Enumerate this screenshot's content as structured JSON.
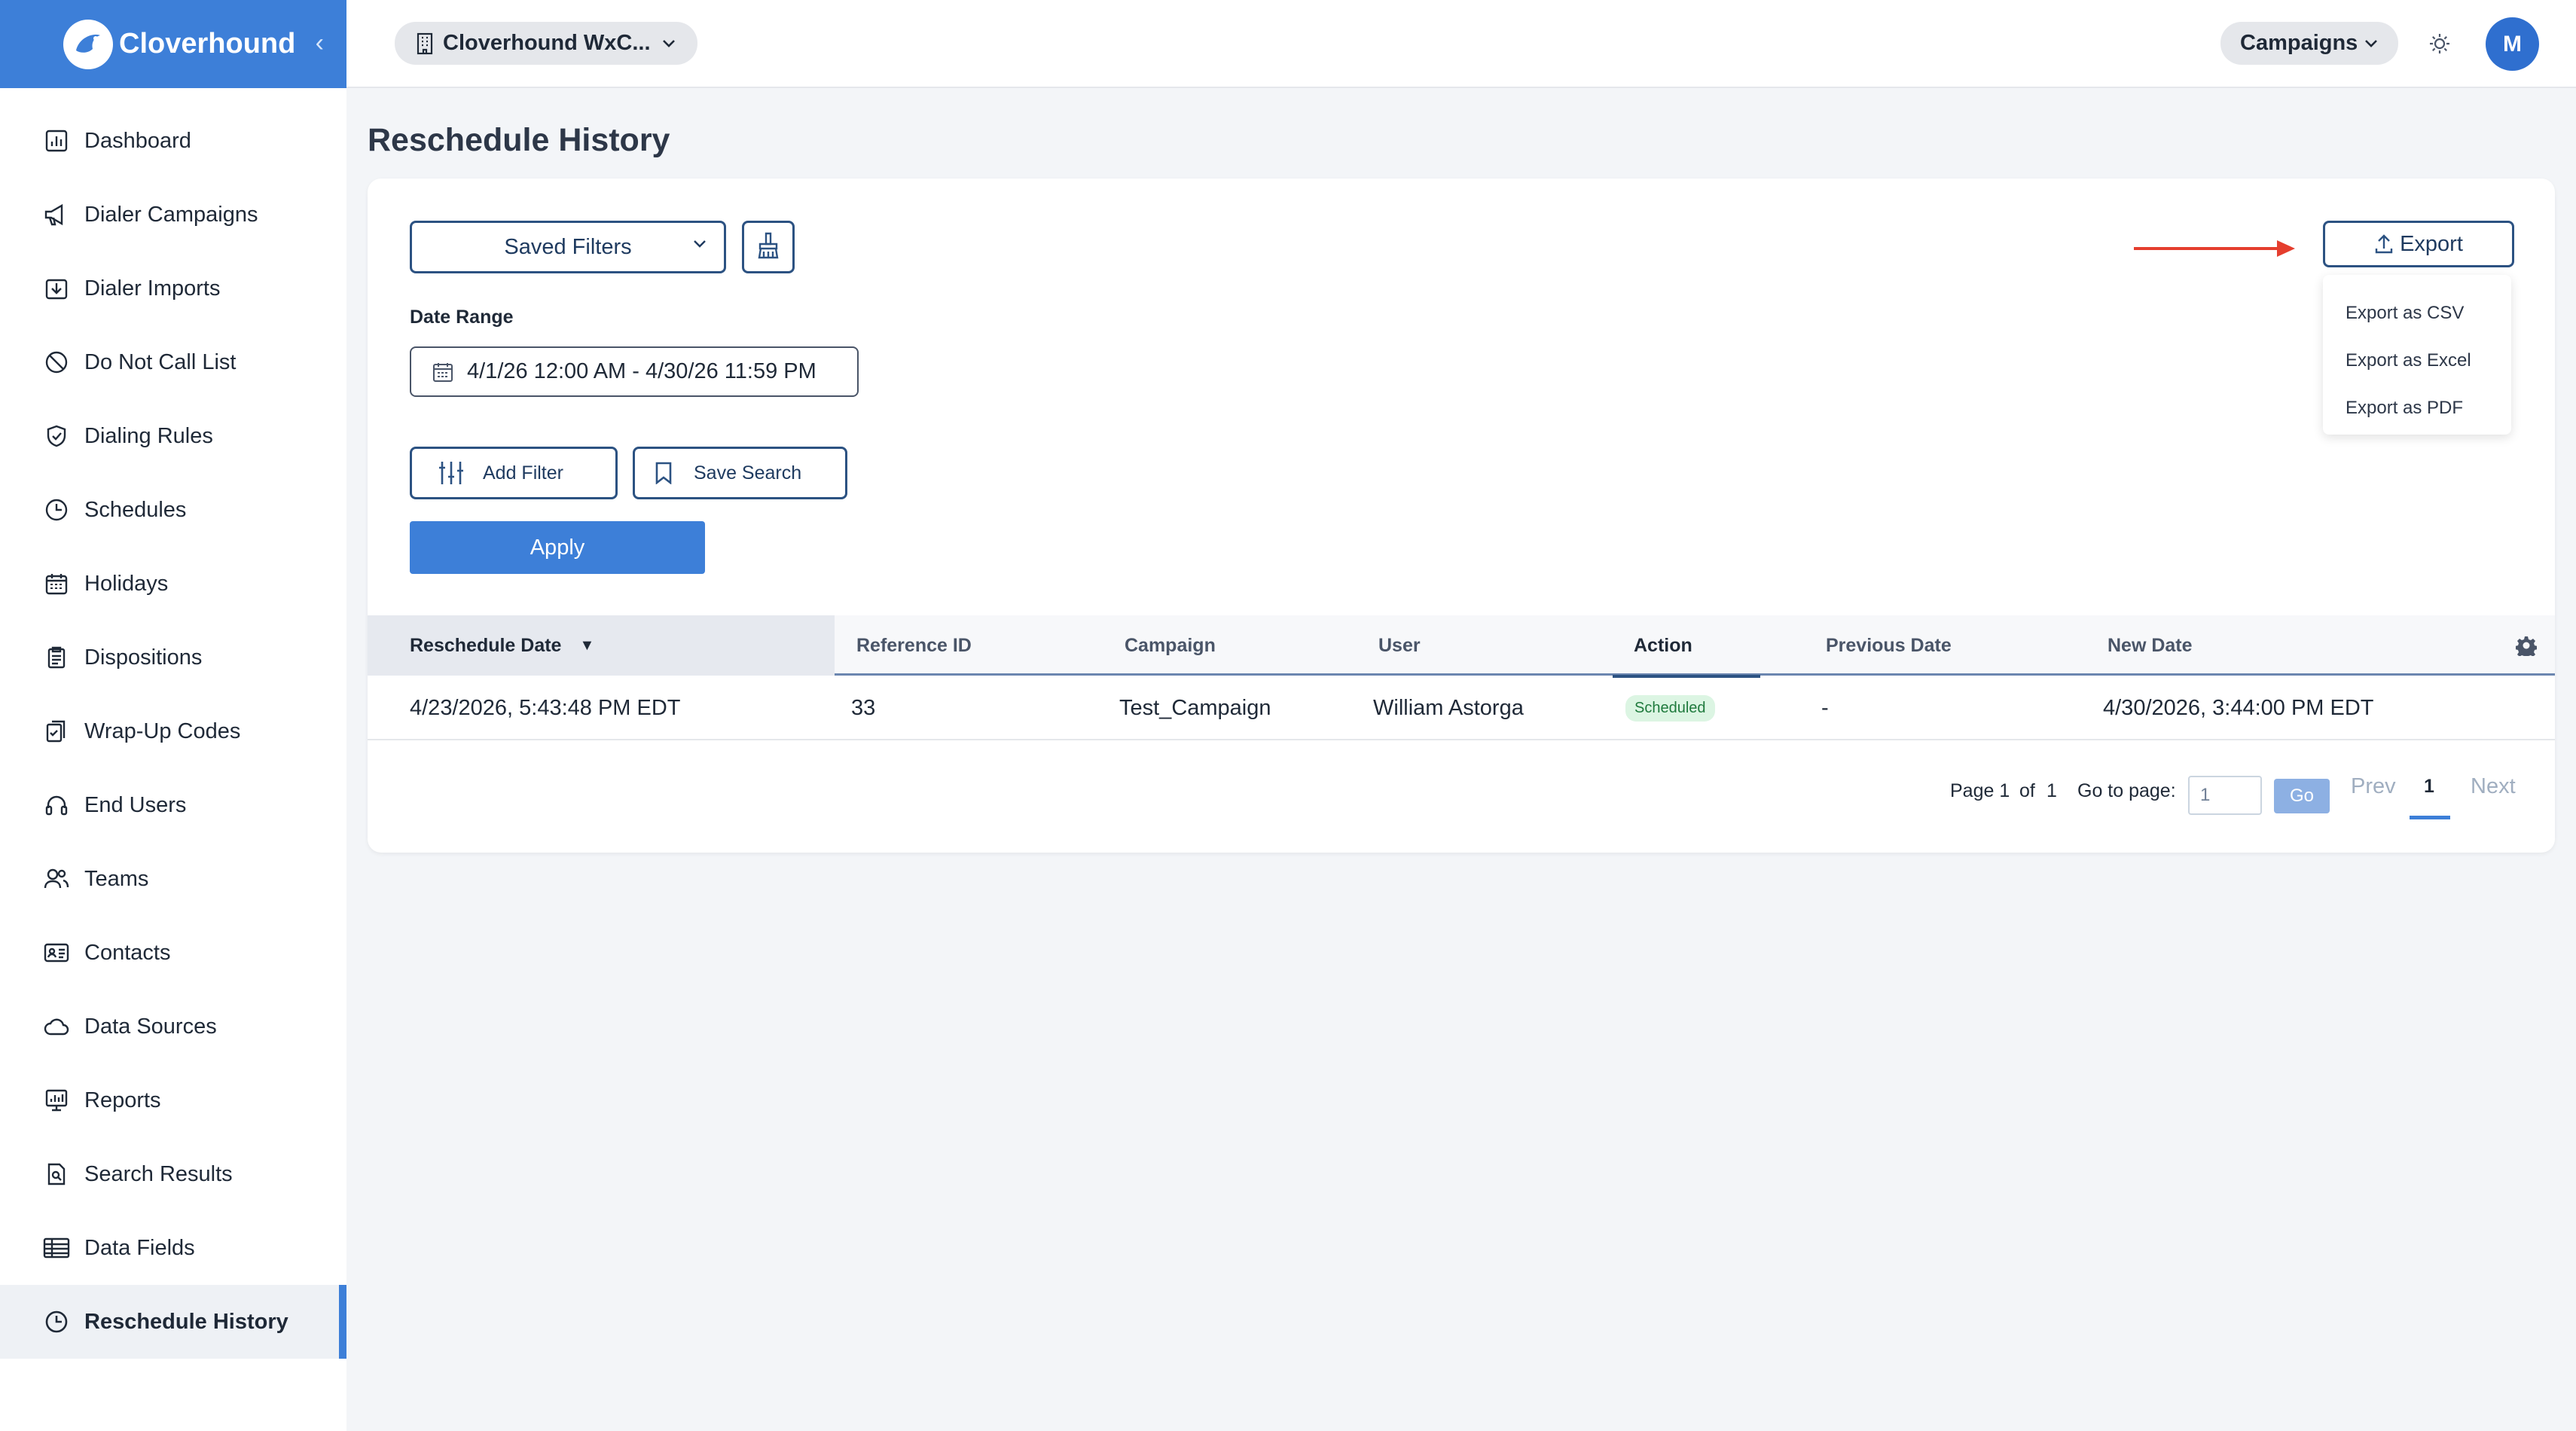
{
  "brand": {
    "name": "Cloverhound"
  },
  "sidebar": {
    "items": [
      {
        "label": "Dashboard",
        "icon": "dashboard-icon"
      },
      {
        "label": "Dialer Campaigns",
        "icon": "megaphone-icon"
      },
      {
        "label": "Dialer Imports",
        "icon": "import-icon"
      },
      {
        "label": "Do Not Call List",
        "icon": "prohibited-icon"
      },
      {
        "label": "Dialing Rules",
        "icon": "shield-icon"
      },
      {
        "label": "Schedules",
        "icon": "clock-icon"
      },
      {
        "label": "Holidays",
        "icon": "calendar-icon"
      },
      {
        "label": "Dispositions",
        "icon": "clipboard-icon"
      },
      {
        "label": "Wrap-Up Codes",
        "icon": "clipboard-check-icon"
      },
      {
        "label": "End Users",
        "icon": "headset-icon"
      },
      {
        "label": "Teams",
        "icon": "users-icon"
      },
      {
        "label": "Contacts",
        "icon": "contact-card-icon"
      },
      {
        "label": "Data Sources",
        "icon": "cloud-icon"
      },
      {
        "label": "Reports",
        "icon": "report-icon"
      },
      {
        "label": "Search Results",
        "icon": "search-document-icon"
      },
      {
        "label": "Data Fields",
        "icon": "table-icon"
      },
      {
        "label": "Reschedule History",
        "icon": "clock-icon",
        "active": true
      }
    ]
  },
  "header": {
    "org": "Cloverhound WxC...",
    "module": "Campaigns",
    "avatar": "M"
  },
  "page": {
    "title": "Reschedule History"
  },
  "filters": {
    "saved_filters": "Saved Filters",
    "date_range_label": "Date Range",
    "date_range_value": "4/1/26 12:00 AM - 4/30/26 11:59 PM",
    "add_filter": "Add Filter",
    "save_search": "Save Search",
    "apply": "Apply"
  },
  "export": {
    "button": "Export",
    "menu": [
      "Export as CSV",
      "Export as Excel",
      "Export as PDF"
    ]
  },
  "table": {
    "columns": [
      "Reschedule Date",
      "Reference ID",
      "Campaign",
      "User",
      "Action",
      "Previous Date",
      "New Date"
    ],
    "sort_indicator": "▼",
    "rows": [
      {
        "reschedule_date": "4/23/2026, 5:43:48 PM EDT",
        "reference_id": "33",
        "campaign": "Test_Campaign",
        "user": "William Astorga",
        "action": "Scheduled",
        "previous_date": "-",
        "new_date": "4/30/2026, 3:44:00 PM EDT"
      }
    ]
  },
  "pagination": {
    "page": "Page 1",
    "of": "of",
    "total": "1",
    "goto_label": "Go to page:",
    "goto_value": "1",
    "go": "Go",
    "prev": "Prev",
    "current": "1",
    "next": "Next"
  },
  "colors": {
    "accent": "#3d7fd8",
    "outline": "#2c5282",
    "arrow": "#e53e2e",
    "badge_bg": "#dcf5e3",
    "badge_text": "#1f7a3d"
  }
}
